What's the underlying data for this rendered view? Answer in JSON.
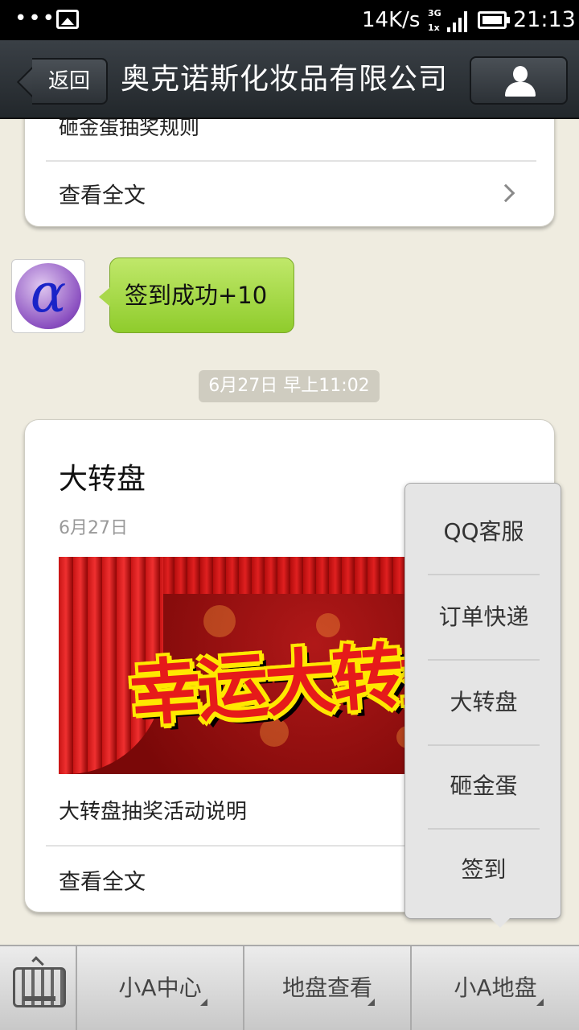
{
  "status_bar": {
    "dots": "•••",
    "speed": "14K/s",
    "net_top": "3G",
    "net_bottom": "1x",
    "time": "21:13",
    "icons": [
      "gallery-icon",
      "signal-icon",
      "battery-icon"
    ]
  },
  "header": {
    "back_label": "返回",
    "title": "奥克诺斯化妆品有限公司",
    "profile_icon": "person-icon"
  },
  "messages": {
    "card1": {
      "partial_title": "砸金蛋抽奖规则",
      "read_all": "查看全文"
    },
    "reply_bubble": "签到成功+10",
    "timestamp": "6月27日 早上11:02",
    "card2": {
      "title": "大转盘",
      "date": "6月27日",
      "banner_text": "幸运大转盘",
      "summary": "大转盘抽奖活动说明",
      "read_all": "查看全文"
    }
  },
  "popup_menu": {
    "items": [
      "QQ客服",
      "订单快递",
      "大转盘",
      "砸金蛋",
      "签到"
    ]
  },
  "bottom_bar": {
    "keyboard_icon": "keyboard-icon",
    "tabs": [
      "小A中心",
      "地盘查看",
      "小A地盘"
    ]
  },
  "colors": {
    "background": "#efece0",
    "header": "#2c3136",
    "bubble": "#a9d84c",
    "menu": "#e5e5e5"
  }
}
